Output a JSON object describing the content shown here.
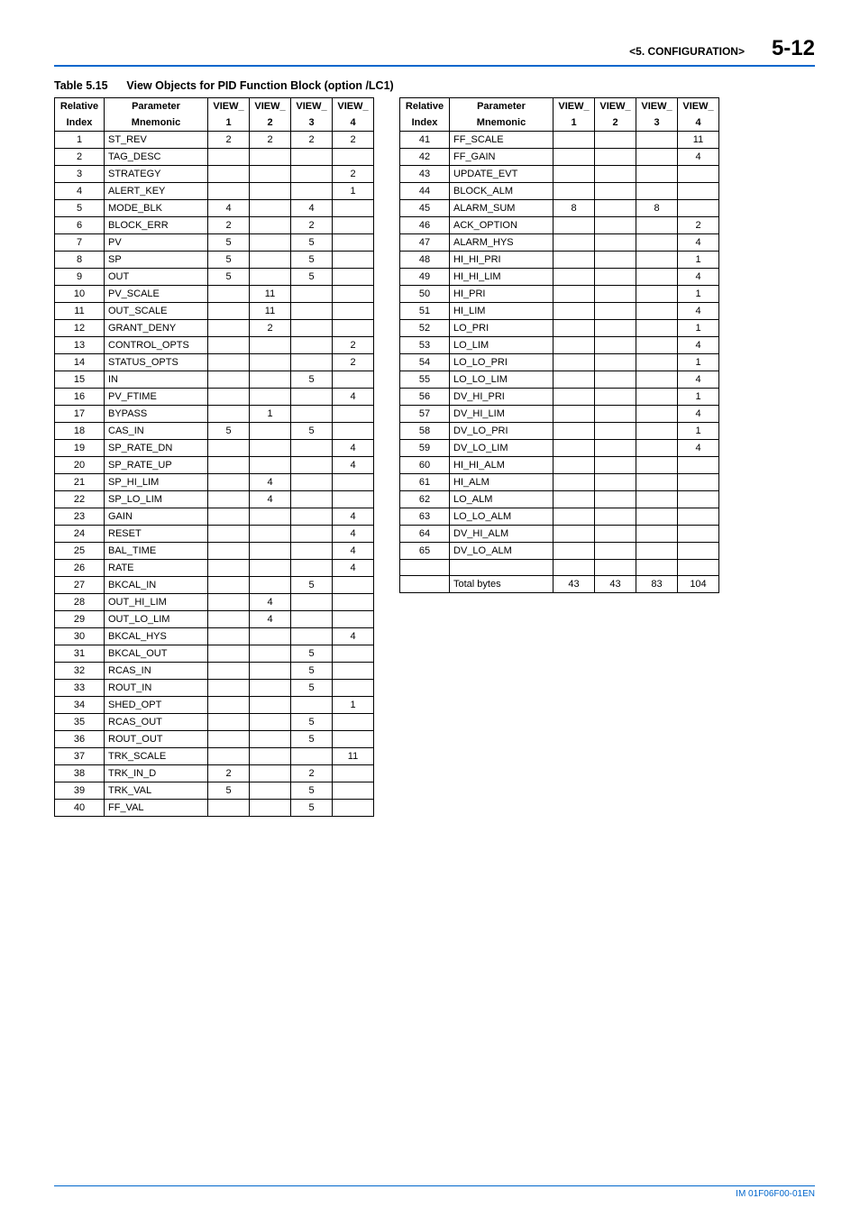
{
  "header": {
    "section": "<5.  CONFIGURATION>",
    "page_num": "5-12"
  },
  "table_title_prefix": "Table 5.15",
  "table_title_text": "View Objects for PID Function Block (option /LC1)",
  "col_headers": {
    "rel_top": "Relative",
    "rel_bot": "Index",
    "param_top": "Parameter",
    "param_bot": "Mnemonic",
    "v1_top": "VIEW_",
    "v1_bot": "1",
    "v2_top": "VIEW_",
    "v2_bot": "2",
    "v3_top": "VIEW_",
    "v3_bot": "3",
    "v4_top": "VIEW_",
    "v4_bot": "4"
  },
  "left_rows": [
    {
      "i": "1",
      "m": "ST_REV",
      "v": [
        "2",
        "2",
        "2",
        "2"
      ]
    },
    {
      "i": "2",
      "m": "TAG_DESC",
      "v": [
        "",
        "",
        "",
        ""
      ]
    },
    {
      "i": "3",
      "m": "STRATEGY",
      "v": [
        "",
        "",
        "",
        "2"
      ]
    },
    {
      "i": "4",
      "m": "ALERT_KEY",
      "v": [
        "",
        "",
        "",
        "1"
      ]
    },
    {
      "i": "5",
      "m": "MODE_BLK",
      "v": [
        "4",
        "",
        "4",
        ""
      ]
    },
    {
      "i": "6",
      "m": "BLOCK_ERR",
      "v": [
        "2",
        "",
        "2",
        ""
      ]
    },
    {
      "i": "7",
      "m": "PV",
      "v": [
        "5",
        "",
        "5",
        ""
      ]
    },
    {
      "i": "8",
      "m": "SP",
      "v": [
        "5",
        "",
        "5",
        ""
      ]
    },
    {
      "i": "9",
      "m": "OUT",
      "v": [
        "5",
        "",
        "5",
        ""
      ]
    },
    {
      "i": "10",
      "m": "PV_SCALE",
      "v": [
        "",
        "11",
        "",
        ""
      ]
    },
    {
      "i": "11",
      "m": "OUT_SCALE",
      "v": [
        "",
        "11",
        "",
        ""
      ]
    },
    {
      "i": "12",
      "m": "GRANT_DENY",
      "v": [
        "",
        "2",
        "",
        ""
      ]
    },
    {
      "i": "13",
      "m": "CONTROL_OPTS",
      "v": [
        "",
        "",
        "",
        "2"
      ]
    },
    {
      "i": "14",
      "m": "STATUS_OPTS",
      "v": [
        "",
        "",
        "",
        "2"
      ]
    },
    {
      "i": "15",
      "m": "IN",
      "v": [
        "",
        "",
        "5",
        ""
      ]
    },
    {
      "i": "16",
      "m": "PV_FTIME",
      "v": [
        "",
        "",
        "",
        "4"
      ]
    },
    {
      "i": "17",
      "m": "BYPASS",
      "v": [
        "",
        "1",
        "",
        ""
      ]
    },
    {
      "i": "18",
      "m": "CAS_IN",
      "v": [
        "5",
        "",
        "5",
        ""
      ]
    },
    {
      "i": "19",
      "m": "SP_RATE_DN",
      "v": [
        "",
        "",
        "",
        "4"
      ]
    },
    {
      "i": "20",
      "m": "SP_RATE_UP",
      "v": [
        "",
        "",
        "",
        "4"
      ]
    },
    {
      "i": "21",
      "m": "SP_HI_LIM",
      "v": [
        "",
        "4",
        "",
        ""
      ]
    },
    {
      "i": "22",
      "m": "SP_LO_LIM",
      "v": [
        "",
        "4",
        "",
        ""
      ]
    },
    {
      "i": "23",
      "m": "GAIN",
      "v": [
        "",
        "",
        "",
        "4"
      ]
    },
    {
      "i": "24",
      "m": "RESET",
      "v": [
        "",
        "",
        "",
        "4"
      ]
    },
    {
      "i": "25",
      "m": "BAL_TIME",
      "v": [
        "",
        "",
        "",
        "4"
      ]
    },
    {
      "i": "26",
      "m": "RATE",
      "v": [
        "",
        "",
        "",
        "4"
      ]
    },
    {
      "i": "27",
      "m": "BKCAL_IN",
      "v": [
        "",
        "",
        "5",
        ""
      ]
    },
    {
      "i": "28",
      "m": "OUT_HI_LIM",
      "v": [
        "",
        "4",
        "",
        ""
      ]
    },
    {
      "i": "29",
      "m": "OUT_LO_LIM",
      "v": [
        "",
        "4",
        "",
        ""
      ]
    },
    {
      "i": "30",
      "m": "BKCAL_HYS",
      "v": [
        "",
        "",
        "",
        "4"
      ]
    },
    {
      "i": "31",
      "m": "BKCAL_OUT",
      "v": [
        "",
        "",
        "5",
        ""
      ]
    },
    {
      "i": "32",
      "m": "RCAS_IN",
      "v": [
        "",
        "",
        "5",
        ""
      ]
    },
    {
      "i": "33",
      "m": "ROUT_IN",
      "v": [
        "",
        "",
        "5",
        ""
      ]
    },
    {
      "i": "34",
      "m": "SHED_OPT",
      "v": [
        "",
        "",
        "",
        "1"
      ]
    },
    {
      "i": "35",
      "m": "RCAS_OUT",
      "v": [
        "",
        "",
        "5",
        ""
      ]
    },
    {
      "i": "36",
      "m": "ROUT_OUT",
      "v": [
        "",
        "",
        "5",
        ""
      ]
    },
    {
      "i": "37",
      "m": "TRK_SCALE",
      "v": [
        "",
        "",
        "",
        "11"
      ]
    },
    {
      "i": "38",
      "m": "TRK_IN_D",
      "v": [
        "2",
        "",
        "2",
        ""
      ]
    },
    {
      "i": "39",
      "m": "TRK_VAL",
      "v": [
        "5",
        "",
        "5",
        ""
      ]
    },
    {
      "i": "40",
      "m": "FF_VAL",
      "v": [
        "",
        "",
        "5",
        ""
      ]
    }
  ],
  "right_rows": [
    {
      "i": "41",
      "m": "FF_SCALE",
      "v": [
        "",
        "",
        "",
        "11"
      ]
    },
    {
      "i": "42",
      "m": "FF_GAIN",
      "v": [
        "",
        "",
        "",
        "4"
      ]
    },
    {
      "i": "43",
      "m": "UPDATE_EVT",
      "v": [
        "",
        "",
        "",
        ""
      ]
    },
    {
      "i": "44",
      "m": "BLOCK_ALM",
      "v": [
        "",
        "",
        "",
        ""
      ]
    },
    {
      "i": "45",
      "m": "ALARM_SUM",
      "v": [
        "8",
        "",
        "8",
        ""
      ]
    },
    {
      "i": "46",
      "m": "ACK_OPTION",
      "v": [
        "",
        "",
        "",
        "2"
      ]
    },
    {
      "i": "47",
      "m": "ALARM_HYS",
      "v": [
        "",
        "",
        "",
        "4"
      ]
    },
    {
      "i": "48",
      "m": "HI_HI_PRI",
      "v": [
        "",
        "",
        "",
        "1"
      ]
    },
    {
      "i": "49",
      "m": "HI_HI_LIM",
      "v": [
        "",
        "",
        "",
        "4"
      ]
    },
    {
      "i": "50",
      "m": "HI_PRI",
      "v": [
        "",
        "",
        "",
        "1"
      ]
    },
    {
      "i": "51",
      "m": "HI_LIM",
      "v": [
        "",
        "",
        "",
        "4"
      ]
    },
    {
      "i": "52",
      "m": "LO_PRI",
      "v": [
        "",
        "",
        "",
        "1"
      ]
    },
    {
      "i": "53",
      "m": "LO_LIM",
      "v": [
        "",
        "",
        "",
        "4"
      ]
    },
    {
      "i": "54",
      "m": "LO_LO_PRI",
      "v": [
        "",
        "",
        "",
        "1"
      ]
    },
    {
      "i": "55",
      "m": "LO_LO_LIM",
      "v": [
        "",
        "",
        "",
        "4"
      ]
    },
    {
      "i": "56",
      "m": "DV_HI_PRI",
      "v": [
        "",
        "",
        "",
        "1"
      ]
    },
    {
      "i": "57",
      "m": "DV_HI_LIM",
      "v": [
        "",
        "",
        "",
        "4"
      ]
    },
    {
      "i": "58",
      "m": "DV_LO_PRI",
      "v": [
        "",
        "",
        "",
        "1"
      ]
    },
    {
      "i": "59",
      "m": "DV_LO_LIM",
      "v": [
        "",
        "",
        "",
        "4"
      ]
    },
    {
      "i": "60",
      "m": "HI_HI_ALM",
      "v": [
        "",
        "",
        "",
        ""
      ]
    },
    {
      "i": "61",
      "m": "HI_ALM",
      "v": [
        "",
        "",
        "",
        ""
      ]
    },
    {
      "i": "62",
      "m": "LO_ALM",
      "v": [
        "",
        "",
        "",
        ""
      ]
    },
    {
      "i": "63",
      "m": "LO_LO_ALM",
      "v": [
        "",
        "",
        "",
        ""
      ]
    },
    {
      "i": "64",
      "m": "DV_HI_ALM",
      "v": [
        "",
        "",
        "",
        ""
      ]
    },
    {
      "i": "65",
      "m": "DV_LO_ALM",
      "v": [
        "",
        "",
        "",
        ""
      ]
    }
  ],
  "right_blank_row": {
    "i": "",
    "m": "",
    "v": [
      "",
      "",
      "",
      ""
    ]
  },
  "right_total_row": {
    "i": "",
    "m": "Total bytes",
    "v": [
      "43",
      "43",
      "83",
      "104"
    ]
  },
  "footer": "IM 01F06F00-01EN"
}
